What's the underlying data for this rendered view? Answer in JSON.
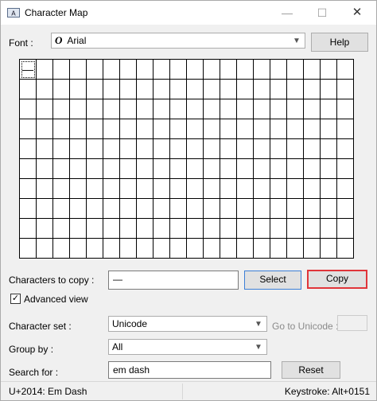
{
  "window": {
    "title": "Character Map",
    "controls": {
      "minimize": "—",
      "maximize": "☐",
      "close": "✕"
    }
  },
  "font": {
    "label": "Font :",
    "value": "Arial",
    "help_label": "Help"
  },
  "grid": {
    "columns": 20,
    "rows": 10,
    "cells": [
      "—"
    ],
    "selected_index": 0
  },
  "copy": {
    "label": "Characters to copy :",
    "value": "—",
    "select_label": "Select",
    "copy_label": "Copy"
  },
  "advanced": {
    "label": "Advanced view",
    "checked": true
  },
  "character_set": {
    "label": "Character set :",
    "value": "Unicode"
  },
  "goto_unicode": {
    "label": "Go to Unicode :",
    "value": ""
  },
  "group_by": {
    "label": "Group by :",
    "value": "All"
  },
  "search": {
    "label": "Search for :",
    "value": "em dash",
    "reset_label": "Reset"
  },
  "status": {
    "info": "U+2014: Em Dash",
    "keystroke": "Keystroke: Alt+0151"
  },
  "colors": {
    "copy_highlight": "#e0353a",
    "select_border": "#3c7fd6"
  }
}
